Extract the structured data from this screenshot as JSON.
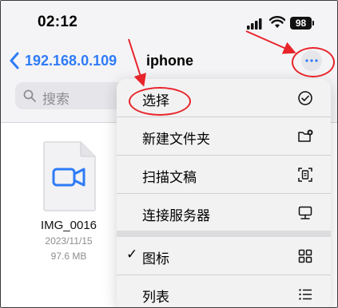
{
  "status_bar": {
    "time": "02:12",
    "battery": "98"
  },
  "nav": {
    "back_label": "192.168.0.109",
    "title": "iphone"
  },
  "search": {
    "placeholder": "搜索"
  },
  "file": {
    "name": "IMG_0016",
    "date": "2023/11/15",
    "size": "97.6 MB"
  },
  "menu": {
    "items": [
      {
        "label": "选择",
        "icon": "checkmark-circle-icon"
      },
      {
        "label": "新建文件夹",
        "icon": "new-folder-icon"
      },
      {
        "label": "扫描文稿",
        "icon": "scan-document-icon"
      },
      {
        "label": "连接服务器",
        "icon": "connect-server-icon"
      },
      {
        "label": "图标",
        "icon": "grid-icon",
        "checked": true
      },
      {
        "label": "列表",
        "icon": "list-icon"
      }
    ]
  },
  "colors": {
    "accent": "#2f7bf6",
    "annotation_red": "#e8232a",
    "video_icon_blue": "#2f7bf6"
  }
}
